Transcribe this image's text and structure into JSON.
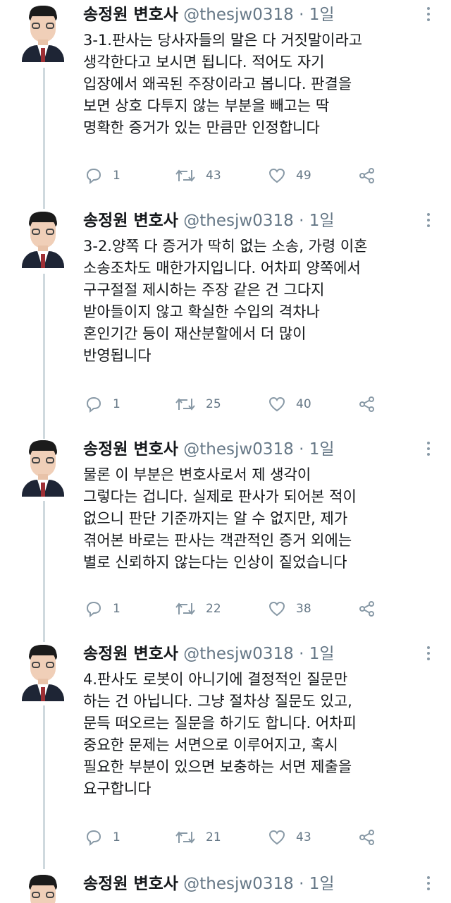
{
  "tweets": [
    {
      "name": "송정원 변호사",
      "handle": "@thesjw0318",
      "dot": "·",
      "time": "1일",
      "body": "3-1.판사는 당사자들의 말은 다 거짓말이라고\n생각한다고 보시면 됩니다. 적어도 자기\n입장에서 왜곡된 주장이라고 봅니다. 판결을\n보면 상호 다투지 않는 부분을 빼고는 딱\n명확한 증거가 있는 만큼만 인정합니다",
      "reply_count": "1",
      "retweet_count": "43",
      "like_count": "49"
    },
    {
      "name": "송정원 변호사",
      "handle": "@thesjw0318",
      "dot": "·",
      "time": "1일",
      "body": "3-2.양쪽 다 증거가 딱히 없는 소송, 가령 이혼\n소송조차도 매한가지입니다. 어차피 양쪽에서\n구구절절  제시하는 주장 같은 건 그다지\n받아들이지 않고 확실한 수입의 격차나\n혼인기간 등이 재산분할에서 더 많이\n반영됩니다",
      "reply_count": "1",
      "retweet_count": "25",
      "like_count": "40"
    },
    {
      "name": "송정원 변호사",
      "handle": "@thesjw0318",
      "dot": "·",
      "time": "1일",
      "body": "물론 이 부분은 변호사로서 제 생각이\n그렇다는 겁니다. 실제로 판사가 되어본 적이\n없으니 판단 기준까지는 알 수 없지만, 제가\n겪어본 바로는 판사는 객관적인 증거 외에는\n별로 신뢰하지 않는다는 인상이 짙었습니다",
      "reply_count": "1",
      "retweet_count": "22",
      "like_count": "38"
    },
    {
      "name": "송정원 변호사",
      "handle": "@thesjw0318",
      "dot": "·",
      "time": "1일",
      "body": "4.판사도 로봇이 아니기에 결정적인 질문만\n하는 건 아닙니다. 그냥 절차상 질문도 있고,\n문득 떠오르는 질문을 하기도 합니다. 어차피\n중요한 문제는 서면으로 이루어지고, 혹시\n필요한 부분이 있으면 보충하는 서면 제출을\n요구합니다",
      "reply_count": "1",
      "retweet_count": "21",
      "like_count": "43"
    },
    {
      "name": "송정원 변호사",
      "handle": "@thesjw0318",
      "dot": "·",
      "time": "1일"
    }
  ],
  "icons": {
    "reply": "reply-icon",
    "retweet": "retweet-icon",
    "like": "heart-icon",
    "share": "share-icon",
    "more": "more-dots-icon"
  },
  "colors": {
    "text": "#14171a",
    "secondary": "#657786",
    "thread_line": "#cfd9de"
  }
}
